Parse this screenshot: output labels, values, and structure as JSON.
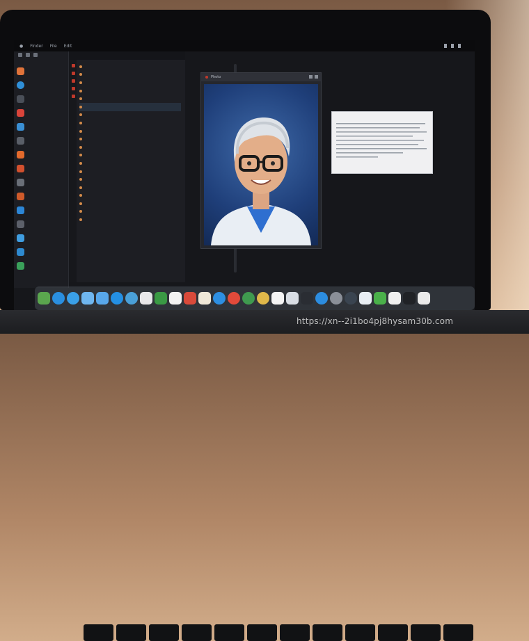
{
  "menubar": {
    "items": [
      "Finder",
      "File",
      "Edit"
    ]
  },
  "window": {
    "portrait_title": "Photo"
  },
  "document": {
    "title": "",
    "lines": [
      "",
      "",
      "",
      "",
      "",
      "",
      "",
      "",
      "",
      ""
    ]
  },
  "brand": "",
  "watermark": "https://xn--2i1bo4pj8hysam30b.com"
}
